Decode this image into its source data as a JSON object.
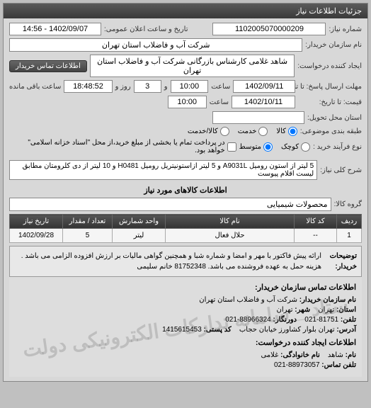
{
  "panel_title": "جزئیات اطلاعات نیاز",
  "fields": {
    "request_no_label": "شماره نیاز:",
    "request_no": "1102005070000209",
    "announce_label": "تاریخ و ساعت اعلان عمومی:",
    "announce_value": "1402/09/07 - 14:56",
    "buyer_name_label": "نام سازمان خریدار:",
    "buyer_name": "شرکت آب و فاضلاب استان تهران",
    "requester_label": "ایجاد کننده درخواست:",
    "requester": "شاهد غلامی کارشناس بازرگانی شرکت آب و فاضلاب استان تهران",
    "contact_btn": "اطلاعات تماس خریدار",
    "deadline_label": "مهلت ارسال پاسخ: تا تاریخ:",
    "deadline_date": "1402/09/11",
    "deadline_time_label": "ساعت",
    "deadline_time": "10:00",
    "remain_label": "و",
    "remain_days": "3",
    "remain_days_label": "روز و",
    "remain_time": "18:48:52",
    "remain_suffix": "ساعت باقی مانده",
    "quote_deadline_label": "قیمت: تا تاریخ:",
    "quote_date": "1402/10/11",
    "quote_time": "10:00",
    "delivery_place_label": "استان محل تحویل:",
    "delivery_place": "",
    "packaging_label": "طبقه بندی موضوعی:",
    "goods_radio": "کالا",
    "services_radio": "خدمت",
    "both_radio": "کالا/خدمت",
    "process_label": "نوع فرآیند خرید :",
    "small_radio": "کوچک",
    "medium_radio": "متوسط",
    "process_note": "در پرداخت تمام یا بخشی از مبلغ خرید،از محل \"اسناد خزانه اسلامی\" خواهد بود.",
    "main_title_label": "شرح کلی نیاز:",
    "main_title": "5 لیتر از استون رومیل A9031L و 5 لیتر ازاستونیتریل رومیل H0481 و 10 لیتر از دی کلرومتان مطابق لیست اقلام پیوست",
    "goods_section": "اطلاعات کالاهای مورد نیاز",
    "goods_group_label": "گروه کالا:",
    "goods_group": "محصولات شیمیایی"
  },
  "table": {
    "headers": [
      "ردیف",
      "کد کالا",
      "نام کالا",
      "واحد شمارش",
      "تعداد / مقدار",
      "تاریخ نیاز"
    ],
    "row": [
      "1",
      "--",
      "حلال فعال",
      "لیتر",
      "5",
      "1402/09/28"
    ]
  },
  "description": {
    "label": "توضیحات خریدار:",
    "text": "ارائه پیش فاکتور با مهر و امضا و شماره شبا و همچنین گواهی مالیات بر ارزش افزوده الزامی می باشد . هزینه حمل به عهده فروشنده می باشد. 81752348 خانم سلیمی"
  },
  "watermark_text": "ستاد _ سامانه تدارکات الکترونیکی دولت",
  "contact": {
    "title": "اطلاعات تماس سازمان خریدار:",
    "org_label": "نام سازمان خریدار:",
    "org": "شرکت آب و فاضلاب استان تهران",
    "city_label": "شهر:",
    "city": "تهران",
    "province_label": "استان:",
    "province": "تهران",
    "fax_label": "دورنگار:",
    "fax": "88966324-021",
    "phone_label": "تلفن:",
    "phone": "81751-021",
    "address_label": "آدرس:",
    "address": "تهران بلوار کشاورز خیابان حجاب",
    "postal_label": "کد پستی:",
    "postal": "1415615453",
    "creator_title": "اطلاعات ایجاد کننده درخواست:",
    "name_label": "نام:",
    "name": "شاهد",
    "family_label": "نام خانوادگی:",
    "family": "غلامی",
    "cphone_label": "تلفن تماس:",
    "cphone": "88973057-021"
  }
}
